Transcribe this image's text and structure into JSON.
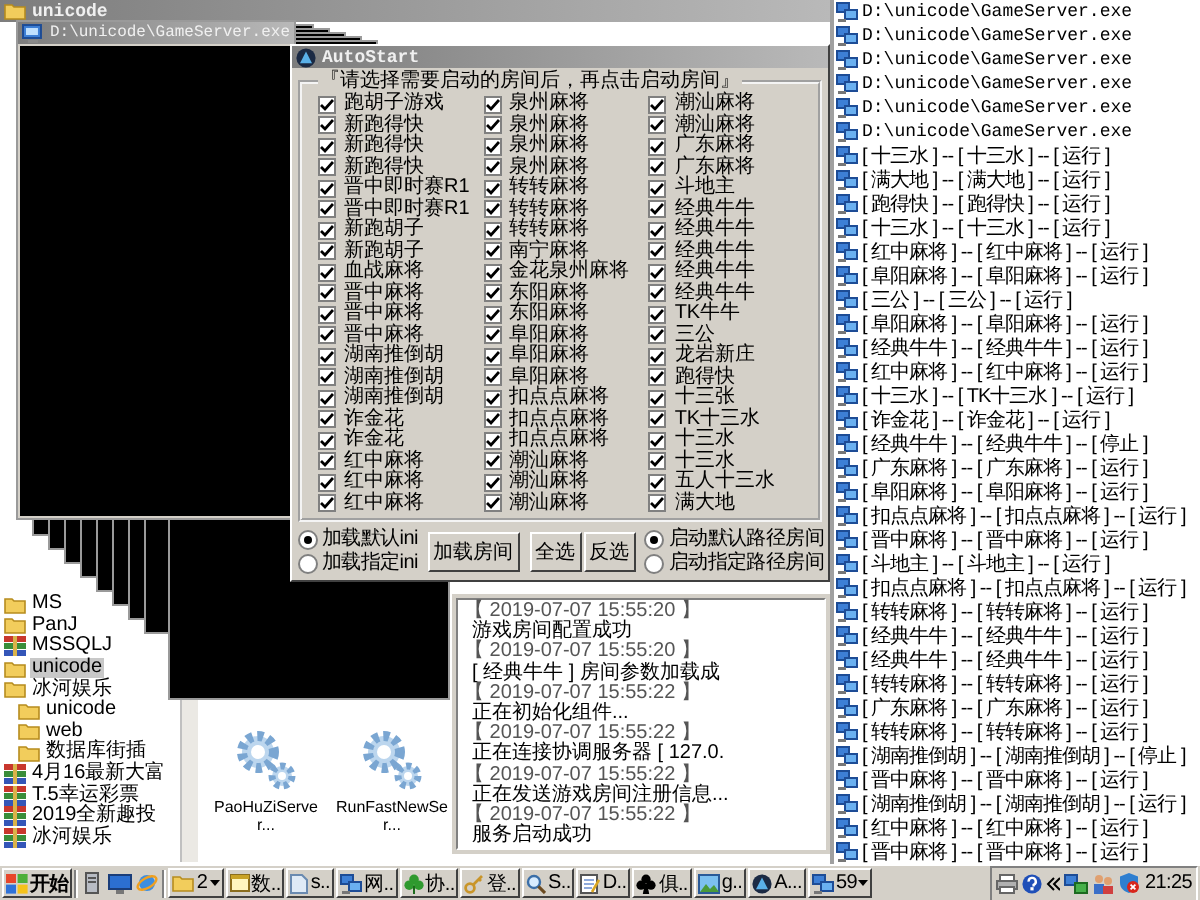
{
  "explorer": {
    "title": "unicode",
    "tree": [
      {
        "label": "MS",
        "kind": "folder",
        "selected": false
      },
      {
        "label": "PanJ",
        "kind": "folder",
        "selected": false
      },
      {
        "label": "MSSQLJ",
        "kind": "archive",
        "selected": false
      },
      {
        "label": "unicode",
        "kind": "folder",
        "selected": true
      },
      {
        "label": "冰河娱乐",
        "kind": "folder",
        "selected": false,
        "children": [
          {
            "label": "unicode",
            "kind": "folder",
            "selected": false
          },
          {
            "label": "web",
            "kind": "folder",
            "selected": false
          },
          {
            "label": "数据库街插",
            "kind": "folder",
            "selected": false
          }
        ]
      },
      {
        "label": "4月16最新大富",
        "kind": "archive",
        "selected": false
      },
      {
        "label": "T.5幸运彩票",
        "kind": "archive",
        "selected": false
      },
      {
        "label": "2019全新趣投",
        "kind": "archive",
        "selected": false
      },
      {
        "label": "冰河娱乐",
        "kind": "archive",
        "selected": false
      }
    ],
    "files": [
      {
        "name": "PaoHuZiServer...",
        "kind": "gear"
      },
      {
        "name": "RunFastNewSer...",
        "kind": "gear"
      }
    ]
  },
  "console": {
    "title": "D:\\unicode\\GameServer.exe"
  },
  "autostart": {
    "title": "AutoStart",
    "group_label": "『请选择需要启动的房间后，再点击启动房间』",
    "columns": [
      {
        "items": [
          {
            "label": "跑胡子游戏",
            "checked": true
          },
          {
            "label": "新跑得快",
            "checked": true
          },
          {
            "label": "新跑得快",
            "checked": true
          },
          {
            "label": "新跑得快",
            "checked": true
          },
          {
            "label": "晋中即时赛R1",
            "checked": true
          },
          {
            "label": "晋中即时赛R1",
            "checked": true
          },
          {
            "label": "新跑胡子",
            "checked": true
          },
          {
            "label": "新跑胡子",
            "checked": true
          },
          {
            "label": "血战麻将",
            "checked": true
          },
          {
            "label": "晋中麻将",
            "checked": true
          },
          {
            "label": "晋中麻将",
            "checked": true
          },
          {
            "label": "晋中麻将",
            "checked": true
          },
          {
            "label": "湖南推倒胡",
            "checked": true
          },
          {
            "label": "湖南推倒胡",
            "checked": true
          },
          {
            "label": "湖南推倒胡",
            "checked": true
          },
          {
            "label": "诈金花",
            "checked": true
          },
          {
            "label": "诈金花",
            "checked": true
          },
          {
            "label": "红中麻将",
            "checked": true
          },
          {
            "label": "红中麻将",
            "checked": true
          },
          {
            "label": "红中麻将",
            "checked": true
          }
        ]
      },
      {
        "items": [
          {
            "label": "泉州麻将",
            "checked": true
          },
          {
            "label": "泉州麻将",
            "checked": true
          },
          {
            "label": "泉州麻将",
            "checked": true
          },
          {
            "label": "泉州麻将",
            "checked": true
          },
          {
            "label": "转转麻将",
            "checked": true
          },
          {
            "label": "转转麻将",
            "checked": true
          },
          {
            "label": "转转麻将",
            "checked": true
          },
          {
            "label": "南宁麻将",
            "checked": true
          },
          {
            "label": "金花泉州麻将",
            "checked": true
          },
          {
            "label": "东阳麻将",
            "checked": true
          },
          {
            "label": "东阳麻将",
            "checked": true
          },
          {
            "label": "阜阳麻将",
            "checked": true
          },
          {
            "label": "阜阳麻将",
            "checked": true
          },
          {
            "label": "阜阳麻将",
            "checked": true
          },
          {
            "label": "扣点点麻将",
            "checked": true
          },
          {
            "label": "扣点点麻将",
            "checked": true
          },
          {
            "label": "扣点点麻将",
            "checked": true
          },
          {
            "label": "潮汕麻将",
            "checked": true
          },
          {
            "label": "潮汕麻将",
            "checked": true
          },
          {
            "label": "潮汕麻将",
            "checked": true
          }
        ]
      },
      {
        "items": [
          {
            "label": "潮汕麻将",
            "checked": true
          },
          {
            "label": "潮汕麻将",
            "checked": true
          },
          {
            "label": "广东麻将",
            "checked": true
          },
          {
            "label": "广东麻将",
            "checked": true
          },
          {
            "label": "斗地主",
            "checked": true
          },
          {
            "label": "经典牛牛",
            "checked": true
          },
          {
            "label": "经典牛牛",
            "checked": true
          },
          {
            "label": "经典牛牛",
            "checked": true
          },
          {
            "label": "经典牛牛",
            "checked": true
          },
          {
            "label": "经典牛牛",
            "checked": true
          },
          {
            "label": "TK牛牛",
            "checked": true
          },
          {
            "label": "三公",
            "checked": true
          },
          {
            "label": "龙岩新庄",
            "checked": true
          },
          {
            "label": "跑得快",
            "checked": true
          },
          {
            "label": "十三张",
            "checked": true
          },
          {
            "label": "TK十三水",
            "checked": true
          },
          {
            "label": "十三水",
            "checked": true
          },
          {
            "label": "十三水",
            "checked": true
          },
          {
            "label": "五人十三水",
            "checked": true
          },
          {
            "label": "满大地",
            "checked": true
          }
        ]
      }
    ],
    "load_options": [
      {
        "label": "加载默认ini",
        "selected": true
      },
      {
        "label": "加载指定ini",
        "selected": false
      }
    ],
    "buttons": [
      "加载房间",
      "全选",
      "反选"
    ],
    "start_options": [
      {
        "label": "启动默认路径房间",
        "selected": true
      },
      {
        "label": "启动指定路径房间",
        "selected": false
      }
    ]
  },
  "log": [
    {
      "time": "【 2019-07-07 15:55:20 】",
      "message": "游戏房间配置成功"
    },
    {
      "time": "【 2019-07-07 15:55:20 】",
      "message": "[ 经典牛牛 ] 房间参数加载成"
    },
    {
      "time": "【 2019-07-07 15:55:22 】",
      "message": "正在初始化组件..."
    },
    {
      "time": "【 2019-07-07 15:55:22 】",
      "message": "正在连接协调服务器 [ 127.0."
    },
    {
      "time": "【 2019-07-07 15:55:22 】",
      "message": "正在发送游戏房间注册信息..."
    },
    {
      "time": "【 2019-07-07 15:55:22 】",
      "message": "服务启动成功"
    }
  ],
  "server_list": [
    {
      "kind": "path",
      "text": "D:\\unicode\\GameServer.exe"
    },
    {
      "kind": "path",
      "text": "D:\\unicode\\GameServer.exe"
    },
    {
      "kind": "path",
      "text": "D:\\unicode\\GameServer.exe"
    },
    {
      "kind": "path",
      "text": "D:\\unicode\\GameServer.exe"
    },
    {
      "kind": "path",
      "text": "D:\\unicode\\GameServer.exe"
    },
    {
      "kind": "path",
      "text": "D:\\unicode\\GameServer.exe"
    },
    {
      "kind": "room",
      "text": "[ 十三水 ] -- [ 十三水 ] -- [ 运行 ]"
    },
    {
      "kind": "room",
      "text": "[ 满大地 ] -- [ 满大地 ] -- [ 运行 ]"
    },
    {
      "kind": "room",
      "text": "[ 跑得快 ] -- [ 跑得快 ] -- [ 运行 ]"
    },
    {
      "kind": "room",
      "text": "[ 十三水 ] -- [ 十三水 ] -- [ 运行 ]"
    },
    {
      "kind": "room",
      "text": "[ 红中麻将 ] -- [ 红中麻将 ] -- [ 运行 ]"
    },
    {
      "kind": "room",
      "text": "[ 阜阳麻将 ] -- [ 阜阳麻将 ] -- [ 运行 ]"
    },
    {
      "kind": "room",
      "text": "[ 三公 ] -- [ 三公 ] -- [ 运行 ]"
    },
    {
      "kind": "room",
      "text": "[ 阜阳麻将 ] -- [ 阜阳麻将 ] -- [ 运行 ]"
    },
    {
      "kind": "room",
      "text": "[ 经典牛牛 ] -- [ 经典牛牛 ] -- [ 运行 ]"
    },
    {
      "kind": "room",
      "text": "[ 红中麻将 ] -- [ 红中麻将 ] -- [ 运行 ]"
    },
    {
      "kind": "room",
      "text": "[ 十三水 ] -- [ TK十三水 ] -- [ 运行 ]"
    },
    {
      "kind": "room",
      "text": "[ 诈金花 ] -- [ 诈金花 ] -- [ 运行 ]"
    },
    {
      "kind": "room",
      "text": "[ 经典牛牛 ] -- [ 经典牛牛 ] -- [ 停止 ]"
    },
    {
      "kind": "room",
      "text": "[ 广东麻将 ] -- [ 广东麻将 ] -- [ 运行 ]"
    },
    {
      "kind": "room",
      "text": "[ 阜阳麻将 ] -- [ 阜阳麻将 ] -- [ 运行 ]"
    },
    {
      "kind": "room",
      "text": "[ 扣点点麻将 ] -- [ 扣点点麻将 ] -- [ 运行 ]"
    },
    {
      "kind": "room",
      "text": "[ 晋中麻将 ] -- [ 晋中麻将 ] -- [ 运行 ]"
    },
    {
      "kind": "room",
      "text": "[ 斗地主 ] -- [ 斗地主 ] -- [ 运行 ]"
    },
    {
      "kind": "room",
      "text": "[ 扣点点麻将 ] -- [ 扣点点麻将 ] -- [ 运行 ]"
    },
    {
      "kind": "room",
      "text": "[ 转转麻将 ] -- [ 转转麻将 ] -- [ 运行 ]"
    },
    {
      "kind": "room",
      "text": "[ 经典牛牛 ] -- [ 经典牛牛 ] -- [ 运行 ]"
    },
    {
      "kind": "room",
      "text": "[ 经典牛牛 ] -- [ 经典牛牛 ] -- [ 运行 ]"
    },
    {
      "kind": "room",
      "text": "[ 转转麻将 ] -- [ 转转麻将 ] -- [ 运行 ]"
    },
    {
      "kind": "room",
      "text": "[ 广东麻将 ] -- [ 广东麻将 ] -- [ 运行 ]"
    },
    {
      "kind": "room",
      "text": "[ 转转麻将 ] -- [ 转转麻将 ] -- [ 运行 ]"
    },
    {
      "kind": "room",
      "text": "[ 湖南推倒胡 ] -- [ 湖南推倒胡 ] -- [ 停止 ]"
    },
    {
      "kind": "room",
      "text": "[ 晋中麻将 ] -- [ 晋中麻将 ] -- [ 运行 ]"
    },
    {
      "kind": "room",
      "text": "[ 湖南推倒胡 ] -- [ 湖南推倒胡 ] -- [ 运行 ]"
    },
    {
      "kind": "room",
      "text": "[ 红中麻将 ] -- [ 红中麻将 ] -- [ 运行 ]"
    },
    {
      "kind": "room",
      "text": "[ 晋中麻将 ] -- [ 晋中麻将 ] -- [ 运行 ]"
    }
  ],
  "taskbar": {
    "start": "开始",
    "buttons": [
      {
        "label": "2",
        "kind": "folder",
        "grouped": true
      },
      {
        "label": "数..",
        "kind": "window",
        "grouped": false
      },
      {
        "label": "s..",
        "kind": "doc",
        "grouped": false
      },
      {
        "label": "网..",
        "kind": "network",
        "grouped": false
      },
      {
        "label": "协..",
        "kind": "clover",
        "grouped": false
      },
      {
        "label": "登..",
        "kind": "key",
        "grouped": false
      },
      {
        "label": "S..",
        "kind": "search",
        "grouped": false
      },
      {
        "label": "D..",
        "kind": "notepad",
        "grouped": false
      },
      {
        "label": "俱..",
        "kind": "club",
        "grouped": false
      },
      {
        "label": "g..",
        "kind": "picture",
        "grouped": false
      },
      {
        "label": "A...",
        "kind": "logo",
        "grouped": false
      },
      {
        "label": "59",
        "kind": "network",
        "grouped": true
      }
    ],
    "clock": "21:25"
  }
}
